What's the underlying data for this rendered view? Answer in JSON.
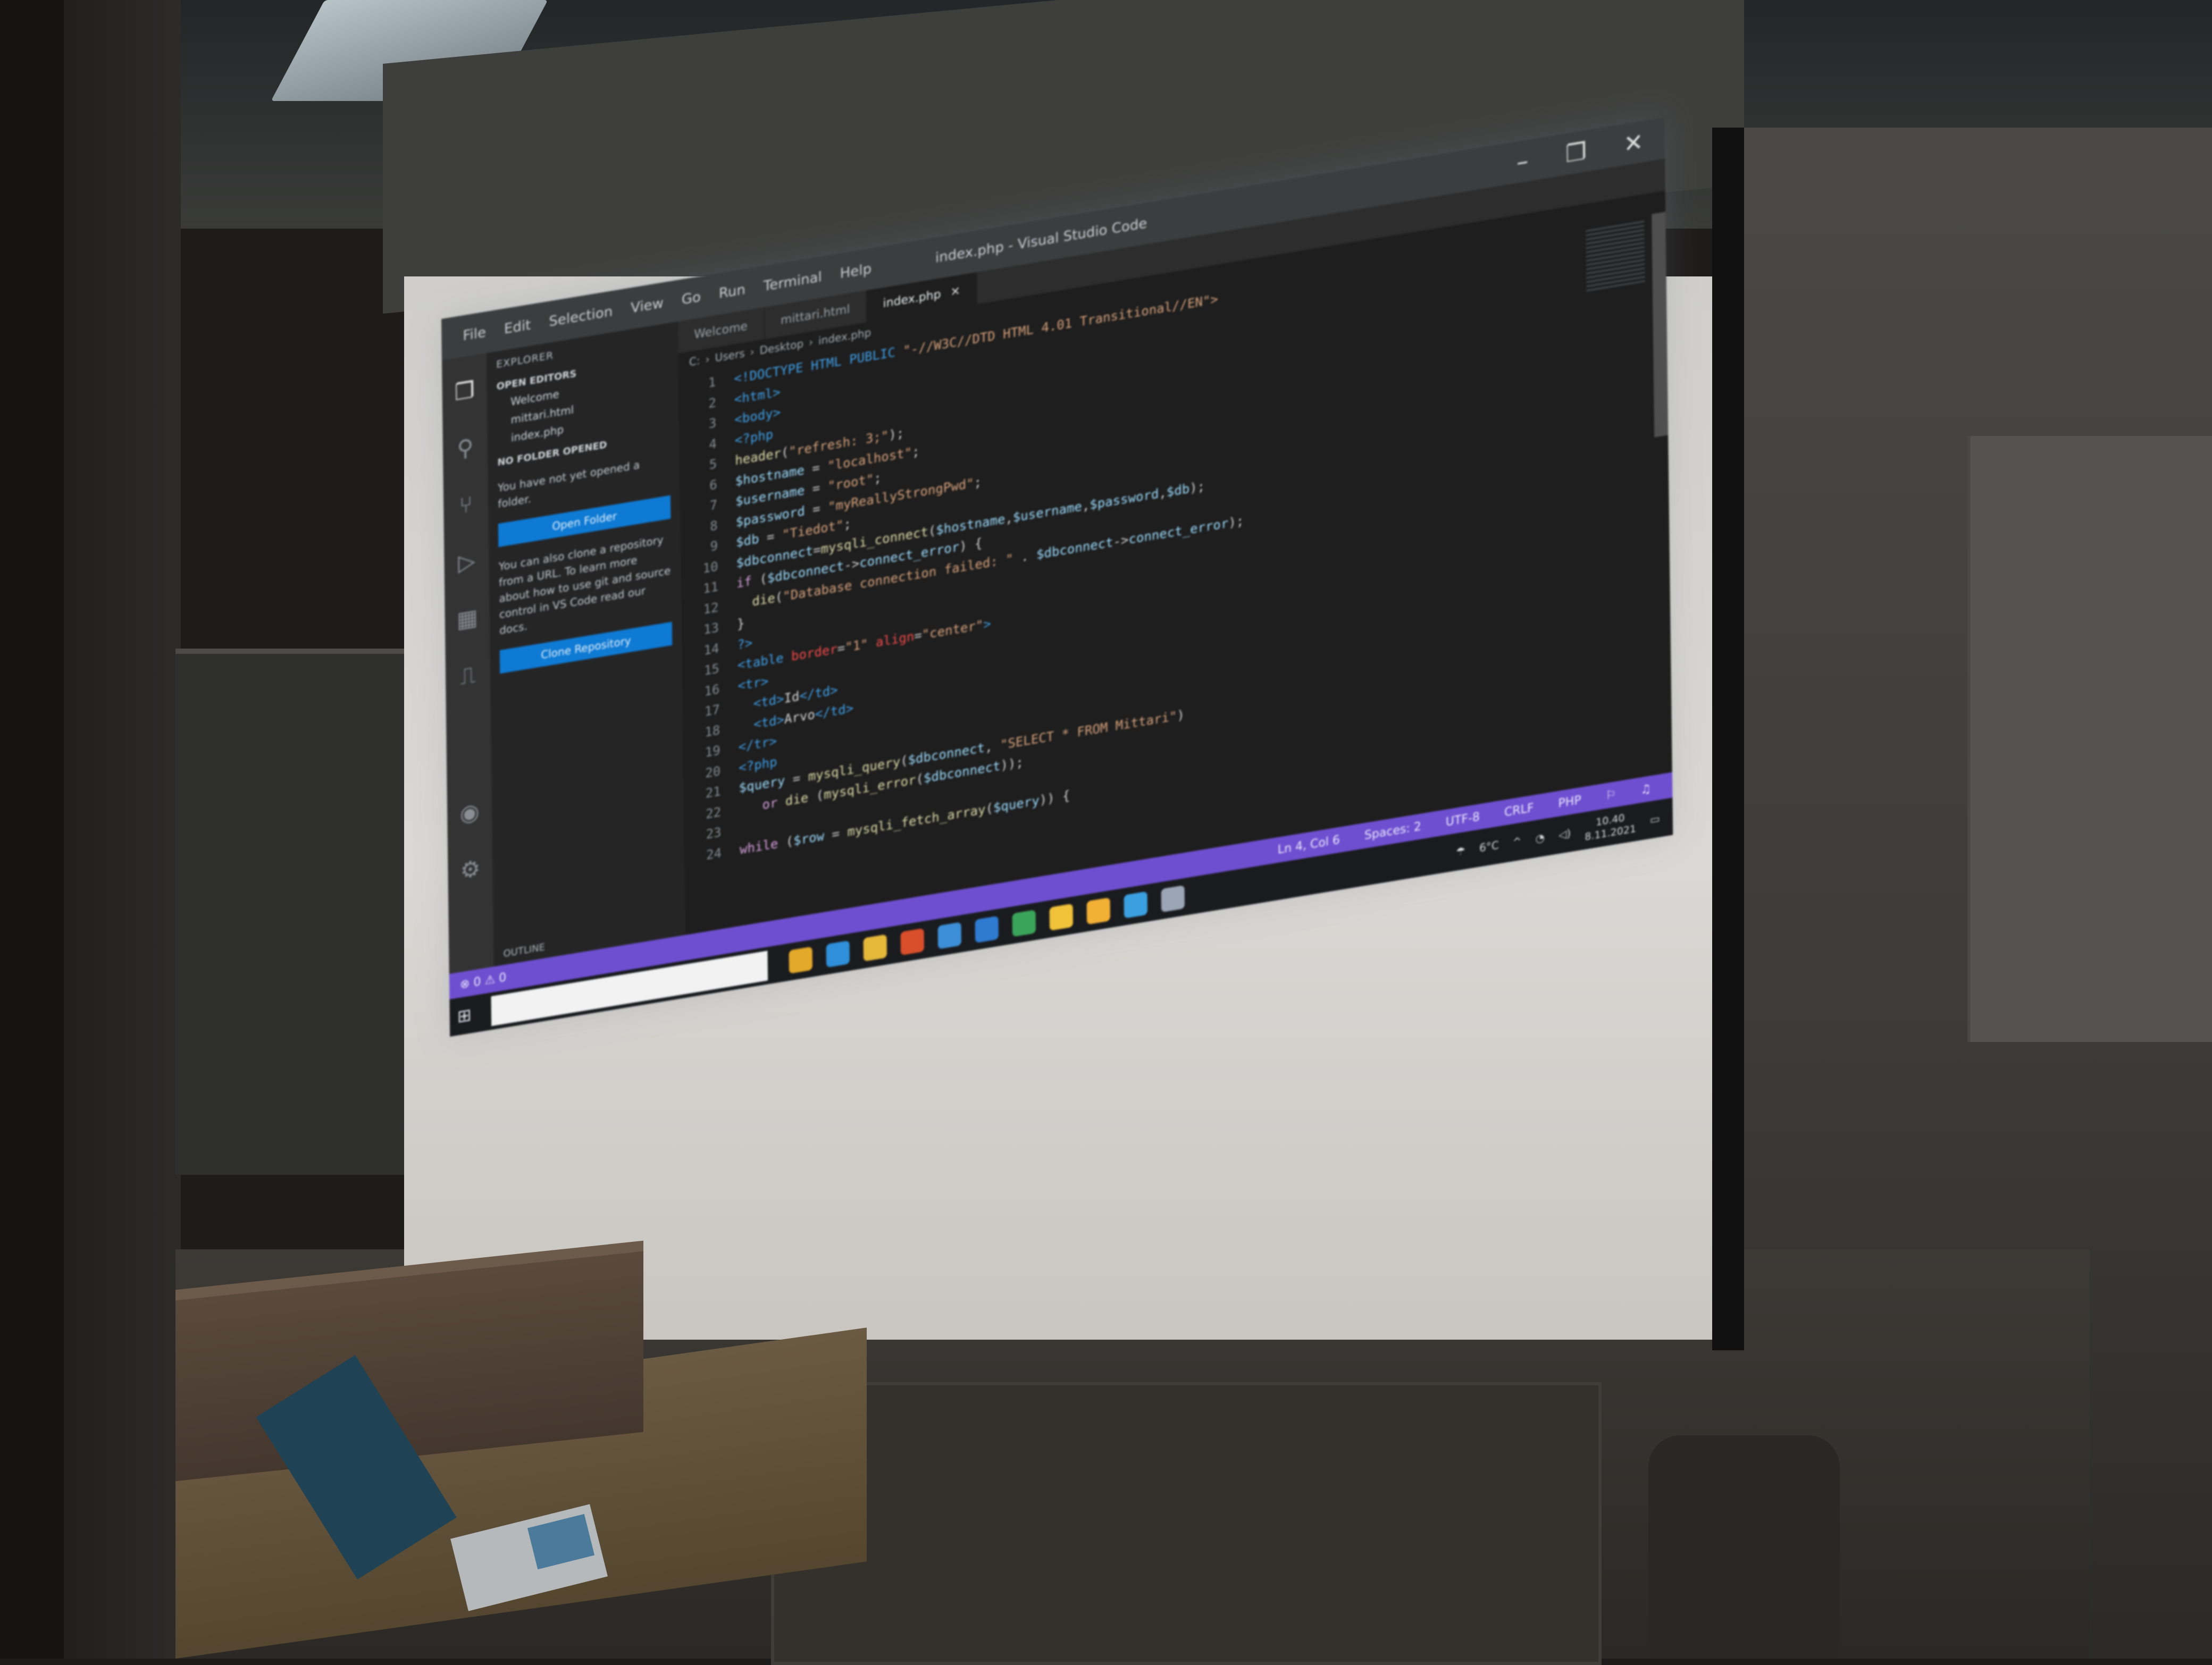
{
  "scene": {
    "description_colors": {
      "wall": "#3d3b38",
      "screen": "#d6d4d0",
      "status_bar": "#6e4fd0"
    }
  },
  "window": {
    "title": "index.php - Visual Studio Code",
    "menu": [
      "File",
      "Edit",
      "Selection",
      "View",
      "Go",
      "Run",
      "Terminal",
      "Help"
    ],
    "controls": [
      "–",
      "❐",
      "✕"
    ]
  },
  "activity_icons": [
    "explorer-icon",
    "search-icon",
    "source-control-icon",
    "run-debug-icon",
    "extensions-icon",
    "remote-icon",
    "account-icon",
    "settings-icon"
  ],
  "sidebar": {
    "header": "EXPLORER",
    "open_editors": "OPEN EDITORS",
    "files": [
      "Welcome",
      "mittari.html",
      "index.php"
    ],
    "no_folder": "NO FOLDER OPENED",
    "message": "You have not yet opened a folder.",
    "open_button": "Open Folder",
    "message2": "You can also clone a repository from a URL. To learn more about how to use git and source control in VS Code read our docs.",
    "clone_button": "Clone Repository",
    "outline": "OUTLINE"
  },
  "tabs": [
    {
      "label": "Welcome",
      "active": false
    },
    {
      "label": "mittari.html",
      "active": false
    },
    {
      "label": "index.php",
      "active": true
    }
  ],
  "breadcrumb": [
    "C:",
    "Users",
    "Desktop",
    "index.php"
  ],
  "code": [
    {
      "n": "1",
      "parts": [
        [
          "tag",
          "<!DOCTYPE HTML PUBLIC"
        ],
        [
          "str",
          " \"-//W3C//DTD HTML 4.01 Transitional//EN\">"
        ]
      ]
    },
    {
      "n": "2",
      "parts": [
        [
          "tag",
          "<html>"
        ]
      ]
    },
    {
      "n": "3",
      "parts": [
        [
          "tag",
          "<body>"
        ]
      ]
    },
    {
      "n": "4",
      "parts": [
        [
          "tag",
          "<?php"
        ]
      ]
    },
    {
      "n": "5",
      "parts": [
        [
          "fn",
          "header"
        ],
        [
          "plain",
          "("
        ],
        [
          "str",
          "\"refresh: 3;\""
        ],
        [
          "plain",
          ");"
        ]
      ]
    },
    {
      "n": "6",
      "parts": [
        [
          "var",
          "$hostname"
        ],
        [
          "plain",
          " = "
        ],
        [
          "str",
          "\"localhost\""
        ],
        [
          "plain",
          ";"
        ]
      ]
    },
    {
      "n": "7",
      "parts": [
        [
          "var",
          "$username"
        ],
        [
          "plain",
          " = "
        ],
        [
          "str",
          "\"root\""
        ],
        [
          "plain",
          ";"
        ]
      ]
    },
    {
      "n": "8",
      "parts": [
        [
          "var",
          "$password"
        ],
        [
          "plain",
          " = "
        ],
        [
          "str",
          "\"myReallyStrongPwd\""
        ],
        [
          "plain",
          ";"
        ]
      ]
    },
    {
      "n": "9",
      "parts": [
        [
          "var",
          "$db"
        ],
        [
          "plain",
          " = "
        ],
        [
          "str",
          "\"Tiedot\""
        ],
        [
          "plain",
          ";"
        ]
      ]
    },
    {
      "n": "10",
      "parts": [
        [
          "var",
          "$dbconnect"
        ],
        [
          "plain",
          "="
        ],
        [
          "fn",
          "mysqli_connect"
        ],
        [
          "plain",
          "("
        ],
        [
          "var",
          "$hostname"
        ],
        [
          "plain",
          ","
        ],
        [
          "var",
          "$username"
        ],
        [
          "plain",
          ","
        ],
        [
          "var",
          "$password"
        ],
        [
          "plain",
          ","
        ],
        [
          "var",
          "$db"
        ],
        [
          "plain",
          ");"
        ]
      ]
    },
    {
      "n": "11",
      "parts": [
        [
          "kw",
          "if"
        ],
        [
          "plain",
          " ("
        ],
        [
          "var",
          "$dbconnect"
        ],
        [
          "plain",
          "->"
        ],
        [
          "var",
          "connect_error"
        ],
        [
          "plain",
          ") {"
        ]
      ]
    },
    {
      "n": "12",
      "parts": [
        [
          "plain",
          "  "
        ],
        [
          "fn",
          "die"
        ],
        [
          "plain",
          "("
        ],
        [
          "str",
          "\"Database connection failed: \""
        ],
        [
          "plain",
          " . "
        ],
        [
          "var",
          "$dbconnect"
        ],
        [
          "plain",
          "->"
        ],
        [
          "var",
          "connect_error"
        ],
        [
          "plain",
          ");"
        ]
      ]
    },
    {
      "n": "13",
      "parts": [
        [
          "plain",
          "}"
        ]
      ]
    },
    {
      "n": "14",
      "parts": [
        [
          "tag",
          "?>"
        ]
      ]
    },
    {
      "n": "15",
      "parts": [
        [
          "tag",
          "<table "
        ],
        [
          "attr",
          "border"
        ],
        [
          "plain",
          "="
        ],
        [
          "str",
          "\"1\" "
        ],
        [
          "attr",
          "align"
        ],
        [
          "plain",
          "="
        ],
        [
          "str",
          "\"center\""
        ],
        [
          "tag",
          ">"
        ]
      ]
    },
    {
      "n": "16",
      "parts": [
        [
          "tag",
          "<tr>"
        ]
      ]
    },
    {
      "n": "17",
      "parts": [
        [
          "plain",
          "  "
        ],
        [
          "tag",
          "<td>"
        ],
        [
          "plain",
          "Id"
        ],
        [
          "tag",
          "</td>"
        ]
      ]
    },
    {
      "n": "18",
      "parts": [
        [
          "plain",
          "  "
        ],
        [
          "tag",
          "<td>"
        ],
        [
          "plain",
          "Arvo"
        ],
        [
          "tag",
          "</td>"
        ]
      ]
    },
    {
      "n": "19",
      "parts": [
        [
          "tag",
          "</tr>"
        ]
      ]
    },
    {
      "n": "20",
      "parts": [
        [
          "tag",
          "<?php"
        ]
      ]
    },
    {
      "n": "21",
      "parts": [
        [
          "var",
          "$query"
        ],
        [
          "plain",
          " = "
        ],
        [
          "fn",
          "mysqli_query"
        ],
        [
          "plain",
          "("
        ],
        [
          "var",
          "$dbconnect"
        ],
        [
          "plain",
          ", "
        ],
        [
          "str",
          "\"SELECT * FROM Mittari\""
        ],
        [
          "plain",
          ")"
        ]
      ]
    },
    {
      "n": "22",
      "parts": [
        [
          "plain",
          "   "
        ],
        [
          "kw",
          "or"
        ],
        [
          "plain",
          " "
        ],
        [
          "fn",
          "die"
        ],
        [
          "plain",
          " ("
        ],
        [
          "fn",
          "mysqli_error"
        ],
        [
          "plain",
          "("
        ],
        [
          "var",
          "$dbconnect"
        ],
        [
          "plain",
          "));"
        ]
      ]
    },
    {
      "n": "23",
      "parts": []
    },
    {
      "n": "24",
      "parts": [
        [
          "kw",
          "while"
        ],
        [
          "plain",
          " ("
        ],
        [
          "var",
          "$row"
        ],
        [
          "plain",
          " = "
        ],
        [
          "fn",
          "mysqli_fetch_array"
        ],
        [
          "plain",
          "("
        ],
        [
          "var",
          "$query"
        ],
        [
          "plain",
          ")) {"
        ]
      ]
    }
  ],
  "status": {
    "left": "⊗ 0 ⚠ 0",
    "right": [
      "Ln 4, Col 6",
      "Spaces: 2",
      "UTF-8",
      "CRLF",
      "PHP"
    ]
  },
  "taskbar": {
    "icon_colors": [
      "#e3a92a",
      "#2f8fd8",
      "#e6b83a",
      "#d94f2b",
      "#3c8fd6",
      "#2e7bd1",
      "#3aa55a",
      "#f0c23a",
      "#f2b035",
      "#3ba0e0",
      "#9aa5b5"
    ],
    "weather": "6°C",
    "time": "10.40",
    "date": "8.11.2021"
  }
}
